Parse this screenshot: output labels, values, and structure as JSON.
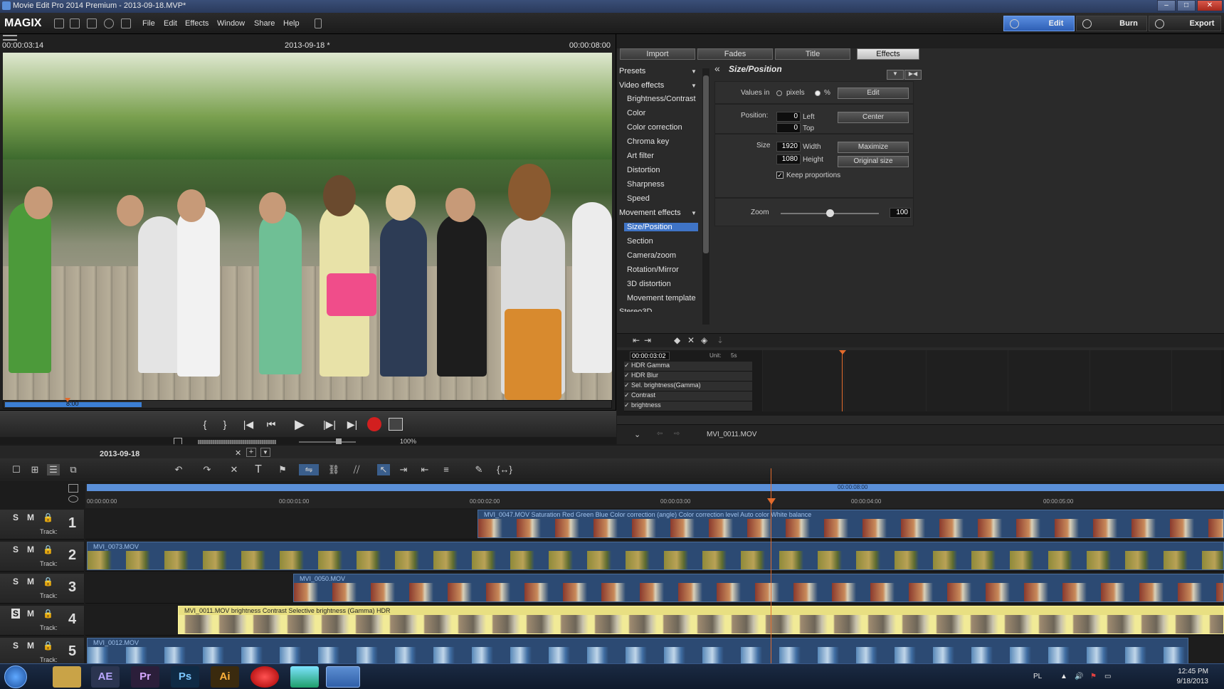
{
  "window": {
    "title": "Movie Edit Pro 2014 Premium - 2013-09-18.MVP*"
  },
  "menubar": {
    "logo": "MAGIX",
    "menu": [
      "File",
      "Edit",
      "Effects",
      "Window",
      "Share",
      "Help"
    ],
    "modes": [
      "Edit",
      "Burn",
      "Export"
    ],
    "active_mode": "Edit"
  },
  "preview": {
    "timecode_left": "00:00:03:14",
    "title": "2013-09-18 *",
    "timecode_right": "00:00:08:00",
    "scrub_label": "8:00",
    "zoom": "100%"
  },
  "tabs": [
    "Import",
    "Fades",
    "Title",
    "Effects"
  ],
  "active_tab": "Effects",
  "effects_list": {
    "presets": "Presets",
    "video_effects": "Video effects",
    "video_items": [
      "Brightness/Contrast",
      "Color",
      "Color correction",
      "Chroma key",
      "Art filter",
      "Distortion",
      "Sharpness",
      "Speed"
    ],
    "movement_effects": "Movement effects",
    "movement_items": [
      "Size/Position",
      "Section",
      "Camera/zoom",
      "Rotation/Mirror",
      "3D distortion",
      "Movement template"
    ],
    "selected": "Size/Position",
    "partial": "Stereo3D"
  },
  "properties": {
    "heading": "Size/Position",
    "values_in_label": "Values in",
    "unit_pixels": "pixels",
    "unit_percent": "%",
    "edit_button": "Edit",
    "position_label": "Position:",
    "left_value": "0",
    "left_label": "Left",
    "top_value": "0",
    "top_label": "Top",
    "center_button": "Center",
    "size_label": "Size",
    "width_value": "1920",
    "width_label": "Width",
    "height_value": "1080",
    "height_label": "Height",
    "maximize_button": "Maximize",
    "original_size_button": "Original size",
    "keep_proportions": "Keep proportions",
    "zoom_label": "Zoom",
    "zoom_value": "100",
    "zoom_slider_level": 0.5
  },
  "keyframes": {
    "time": "00:00:03:02",
    "unit_label": "Unit:",
    "unit_value": "5s",
    "rows": [
      "HDR Gamma",
      "HDR Blur",
      "Sel. brightness(Gamma)",
      "Contrast",
      "brightness"
    ]
  },
  "right_footer": {
    "clip_name": "MVI_0011.MOV"
  },
  "timeline": {
    "project": "2013-09-18",
    "ruler_marker": "00:00:08:00",
    "ticks": [
      "00:00:00:00",
      "00:00:01:00",
      "00:00:02:00",
      "00:00:03:00",
      "00:00:04:00",
      "00:00:05:00"
    ],
    "track_word": "Track:",
    "tracks": [
      {
        "n": "1",
        "clip": "MVI_0047.MOV   Saturation   Red   Green   Blue   Color correction (angle)   Color correction level   Auto color   White balance"
      },
      {
        "n": "2",
        "clip": "MVI_0073.MOV"
      },
      {
        "n": "3",
        "clip": "MVI_0050.MOV"
      },
      {
        "n": "4",
        "clip": "MVI_0011.MOV   brightness   Contrast   Selective brightness (Gamma)   HDR"
      },
      {
        "n": "5",
        "clip": "MVI_0012.MOV"
      }
    ]
  },
  "taskbar": {
    "apps": [
      "AE",
      "Pr",
      "Ps",
      "Ai"
    ],
    "lang": "PL",
    "time": "12:45 PM",
    "date": "9/18/2013"
  },
  "colors": {
    "accent": "#3f74c6",
    "playhead": "#e36b2c",
    "selected_clip": "#e8df82"
  }
}
